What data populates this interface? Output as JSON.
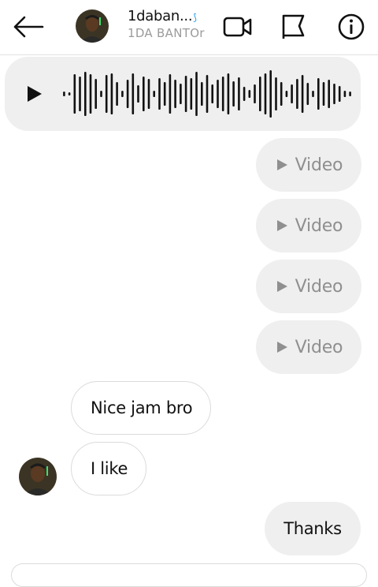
{
  "header": {
    "contact_name": "1daban...",
    "verified_mark": "⟆",
    "contact_username": "1DA BANTOr",
    "icons": {
      "back": "arrow-left-icon",
      "video_call": "video-camera-icon",
      "report": "flag-icon",
      "info": "info-icon"
    }
  },
  "thread": {
    "audio_message": {
      "icon": "play-icon",
      "waveform": "audio-waveform"
    },
    "video_messages": [
      {
        "label": "Video"
      },
      {
        "label": "Video"
      },
      {
        "label": "Video"
      },
      {
        "label": "Video"
      }
    ],
    "incoming_messages": [
      {
        "text": "Nice jam bro"
      },
      {
        "text": "I like"
      }
    ],
    "outgoing_messages": [
      {
        "text": "Thanks"
      }
    ]
  },
  "colors": {
    "bubble_gray": "#efefef",
    "muted_text": "#8f8f8f",
    "verified_blue": "#1d9bf0",
    "border": "#dbdbdb"
  }
}
